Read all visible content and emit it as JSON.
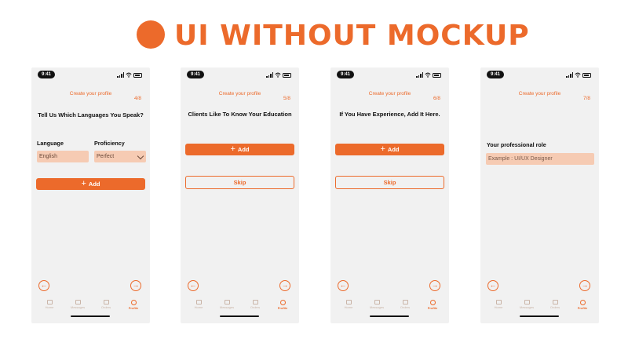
{
  "banner": {
    "title": "UI WITHOUT MOCKUP"
  },
  "colors": {
    "accent": "#EC6A2B",
    "field_bg": "#F6CBB3",
    "screen_bg": "#F1F1F1"
  },
  "status": {
    "time": "9:41"
  },
  "tabs": [
    "Home",
    "Messages",
    "Orders",
    "Profile"
  ],
  "screens": [
    {
      "header": "Create your profile",
      "step": "4/8",
      "question": "Tell Us Which Languages You Speak?",
      "language_label": "Language",
      "proficiency_label": "Proficiency",
      "language_value": "English",
      "proficiency_value": "Perfect",
      "add_label": "Add"
    },
    {
      "header": "Create your profile",
      "step": "5/8",
      "question": "Clients Like To Know Your Education",
      "add_label": "Add",
      "skip_label": "Skip"
    },
    {
      "header": "Create your profile",
      "step": "6/8",
      "question": "If You Have Experience, Add It Here.",
      "add_label": "Add",
      "skip_label": "Skip"
    },
    {
      "header": "Create your profile",
      "step": "7/8",
      "role_label": "Your professional role",
      "role_placeholder": "Example : UI/UX Designer"
    }
  ]
}
